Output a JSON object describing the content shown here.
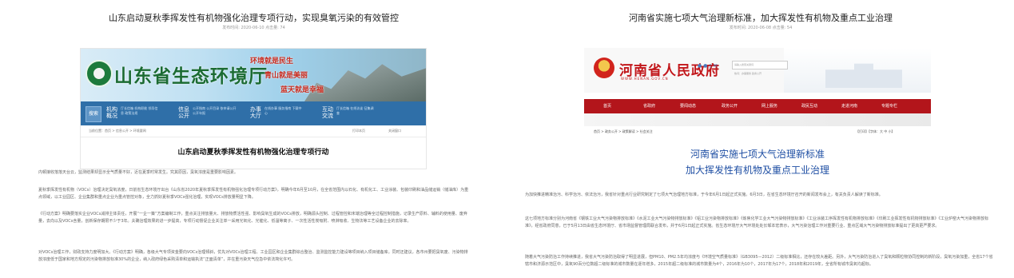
{
  "left": {
    "title": "山东启动夏秋季挥发性有机物强化治理专项行动，实现臭氧污染的有效管控",
    "meta": "发布时间:  2020-06-10  点击量:  74",
    "shot": {
      "site_name": "山东省生态环境厅",
      "slogans": [
        "环境就是民生",
        "青山就是美丽",
        "蓝天就是幸福"
      ],
      "search_label": "搜索",
      "nav": [
        {
          "label": "机构概况",
          "sub": [
            "厅长信箱",
            "机构职能",
            "领导信息",
            "政策法规"
          ]
        },
        {
          "label": "信息公开",
          "sub": [
            "公开指南",
            "公开目录",
            "依申请公开",
            "公开年报"
          ]
        },
        {
          "label": "办事大厅",
          "sub": [
            "在线办事",
            "服务指南",
            "下载中心"
          ]
        },
        {
          "label": "互动交流",
          "sub": [
            "厅长信箱",
            "在线访谈",
            "征集调查"
          ]
        }
      ],
      "crumb": "当前位置：首页 > 信息公开 > 环境要闻",
      "tools": [
        "打印本页",
        "关闭窗口"
      ],
      "article_title": "山东启动夏秋季挥发性有机物强化治理专项行动"
    },
    "paragraphs": [
      "内顿接收落落天台云，监测结果却显示全气质量不好，近在夏季时常发生。究其原因，臭氧浓度是重要影响因素。",
      "夏秋季挥发性有机物（VOCs）治理决定臭氧浓度，日前省生态环境厅出台《山东省2020年夏秋季挥发性有机物强化治理专项行动方案》，明确今年6月至10月，在全省范围内以石化、有机化工、工业涂装、包装印刷和油品储运销（储油库）为重点领域，以工业园区、企业集群和重点企业为重点管控对象，全力抓好夏秋季VOCs强化治理，实现VOCs排放量明显下降。",
      "《行动方案》明确要落实企业VOCs减排主体责任，开展“一企一策”方案编制工作，重点关注排放量大、排放物质活性强、影响臭氧生成的VOCs排放，明确源头控制、过程管控和末端治理等全过程控制措施，记录生产原料、辅料的使用量、废弃量，去向以及VOCs含量，创新保存期限不少于3年。夫确治理效果的进一步提高，专项行动督促企业关注单一采用光氧化、光催化、低温等离子、一次性活性炭吸附、喷淋吸收、生物法等工艺设备企业的去除率。",
      "对VOCs治理工作，财政支持力度明加大。《行动方案》明确，各级大气专项资金要向VOCs治理倾斜，优先对VOCs治理工程、工业园区和企业集群综合整治、监测监控能力建设等项目纳入项目储备库。同时还建议，各市州要把臭氧废、污染物排放浓度低于国家和地方规定的污染物排放标准30%的企业，纳入政府绿色采购清单和运输执法“正面清单”，并在重污染天气应急中依法简化许可。"
    ]
  },
  "right": {
    "title": "河南省实施七项大气治理新标准，加大挥发性有机物及重点工业治理",
    "meta": "发布时间:  2020-06-08  点击量:  54",
    "shot": {
      "site_name": "河南省人民政府",
      "url": "WWW.HENAN.GOV.CN",
      "search_placeholder": "请输入搜索关键词",
      "hot_words": "热词：办事服务 政务公开",
      "nav": [
        "首页",
        "省政府",
        "要闻动态",
        "政务公开",
        "网上服务",
        "政民互动",
        "走进河南",
        "专题专栏"
      ],
      "crumb": "首页 > 政务公开 > 政策解读 > 社会关注",
      "font_tools": "【打印】【字体：大 中 小】",
      "article_title_lines": [
        "河南省实施七项大气治理新标准",
        "加大挥发性有机物及重点工业治理"
      ]
    },
    "paragraphs": [
      "为加快推进精准治污、科学治污、依法治污，我省针对重点行业研究制定了七项大气治理地方标准，于今年6月1日起正式实施。6月3日，在省生态环境厅召开的新闻发布会上，有关负责人解读了新标准。",
      "这七项地方标准分别为河南省《钢铁工业大气污染物排放标准》《水泥工业大气污染物排放标准》《铝工业污染物排放标准》《炼焦化学工业大气污染物排放标准》《工业涂装工序挥发性有机物排放标准》《印刷工业挥发性有机物排放标准》《工业炉窑大气污染物排放标准》，经省政府同意，已于5月13日由省生态环境厅、省市场监督管理局联合发布，并于6月1日起正式实施。省生态环境厅大气环境处处长邹本宏表示，大气污染治理工作对重要行业、重点区域大气污染物排放标准提出了更高更严要求。",
      "随着大气污染防治工作持续推进，我省大气污染防治取得了明显进展，但PM10、PM2.5年均浓度与《环境空气质量标准》（GB3095—2012）二级标准相比，还存在较大差距。另外，大气污染防治进入了臭氧和颗粒物协同控制的新阶段，臭氧污染加重，全省17个省辖市和济源示范区中，臭氧90百分位数超二级标准的城市数量在逐年增多，2015年超二级标准的城市数量为4个，2016年为10个，2017年为17个，2018年和2019年，全省所有城市臭氧均超标。"
    ]
  }
}
